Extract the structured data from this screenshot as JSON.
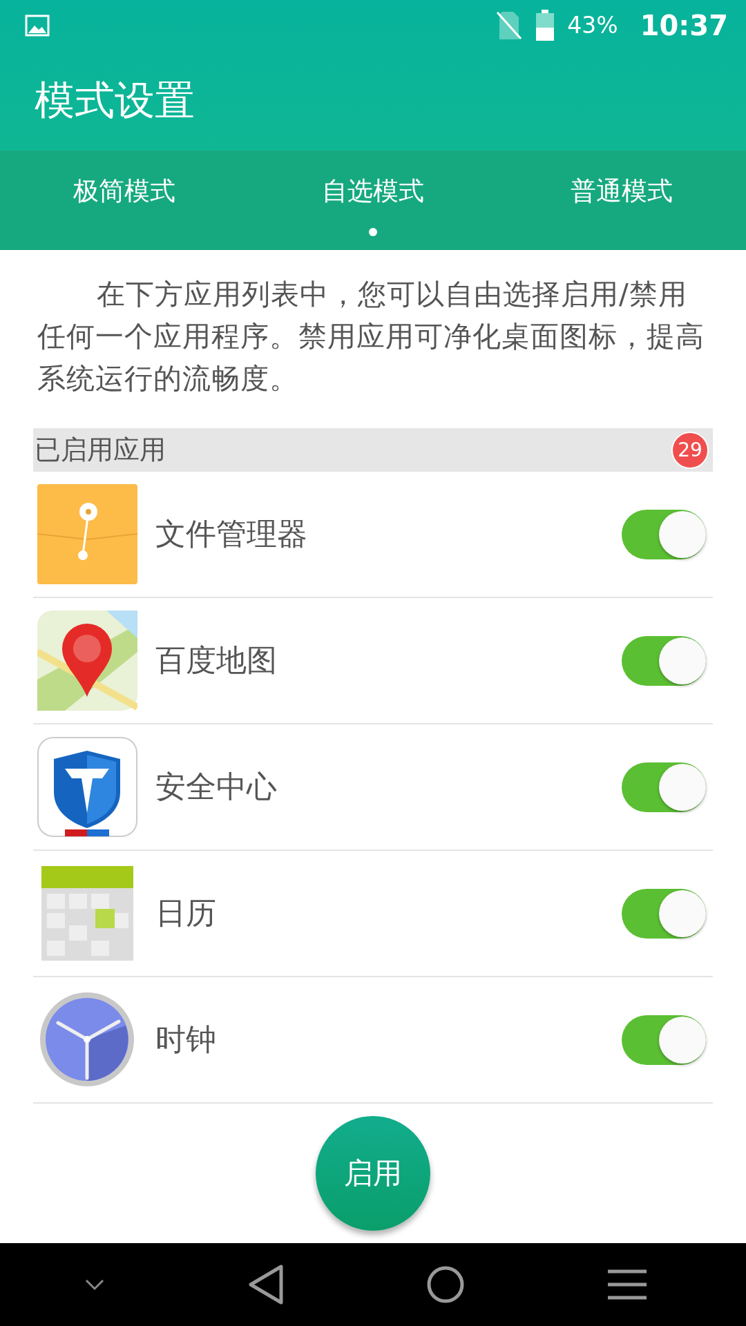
{
  "status_bar": {
    "battery": "43%",
    "time": "10:37"
  },
  "title": "模式设置",
  "tabs": [
    {
      "label": "极简模式",
      "selected": false
    },
    {
      "label": "自选模式",
      "selected": true
    },
    {
      "label": "普通模式",
      "selected": false
    }
  ],
  "description": "在下方应用列表中，您可以自由选择启用/禁用任何一个应用程序。禁用应用可净化桌面图标，提高系统运行的流畅度。",
  "section": {
    "title": "已启用应用",
    "count": "29"
  },
  "apps": [
    {
      "name": "文件管理器",
      "kind": "files",
      "on": true
    },
    {
      "name": "百度地图",
      "kind": "map",
      "on": true
    },
    {
      "name": "安全中心",
      "kind": "shield",
      "on": true
    },
    {
      "name": "日历",
      "kind": "calendar",
      "on": true
    },
    {
      "name": "时钟",
      "kind": "clock",
      "on": true
    }
  ],
  "action_button": "启用"
}
